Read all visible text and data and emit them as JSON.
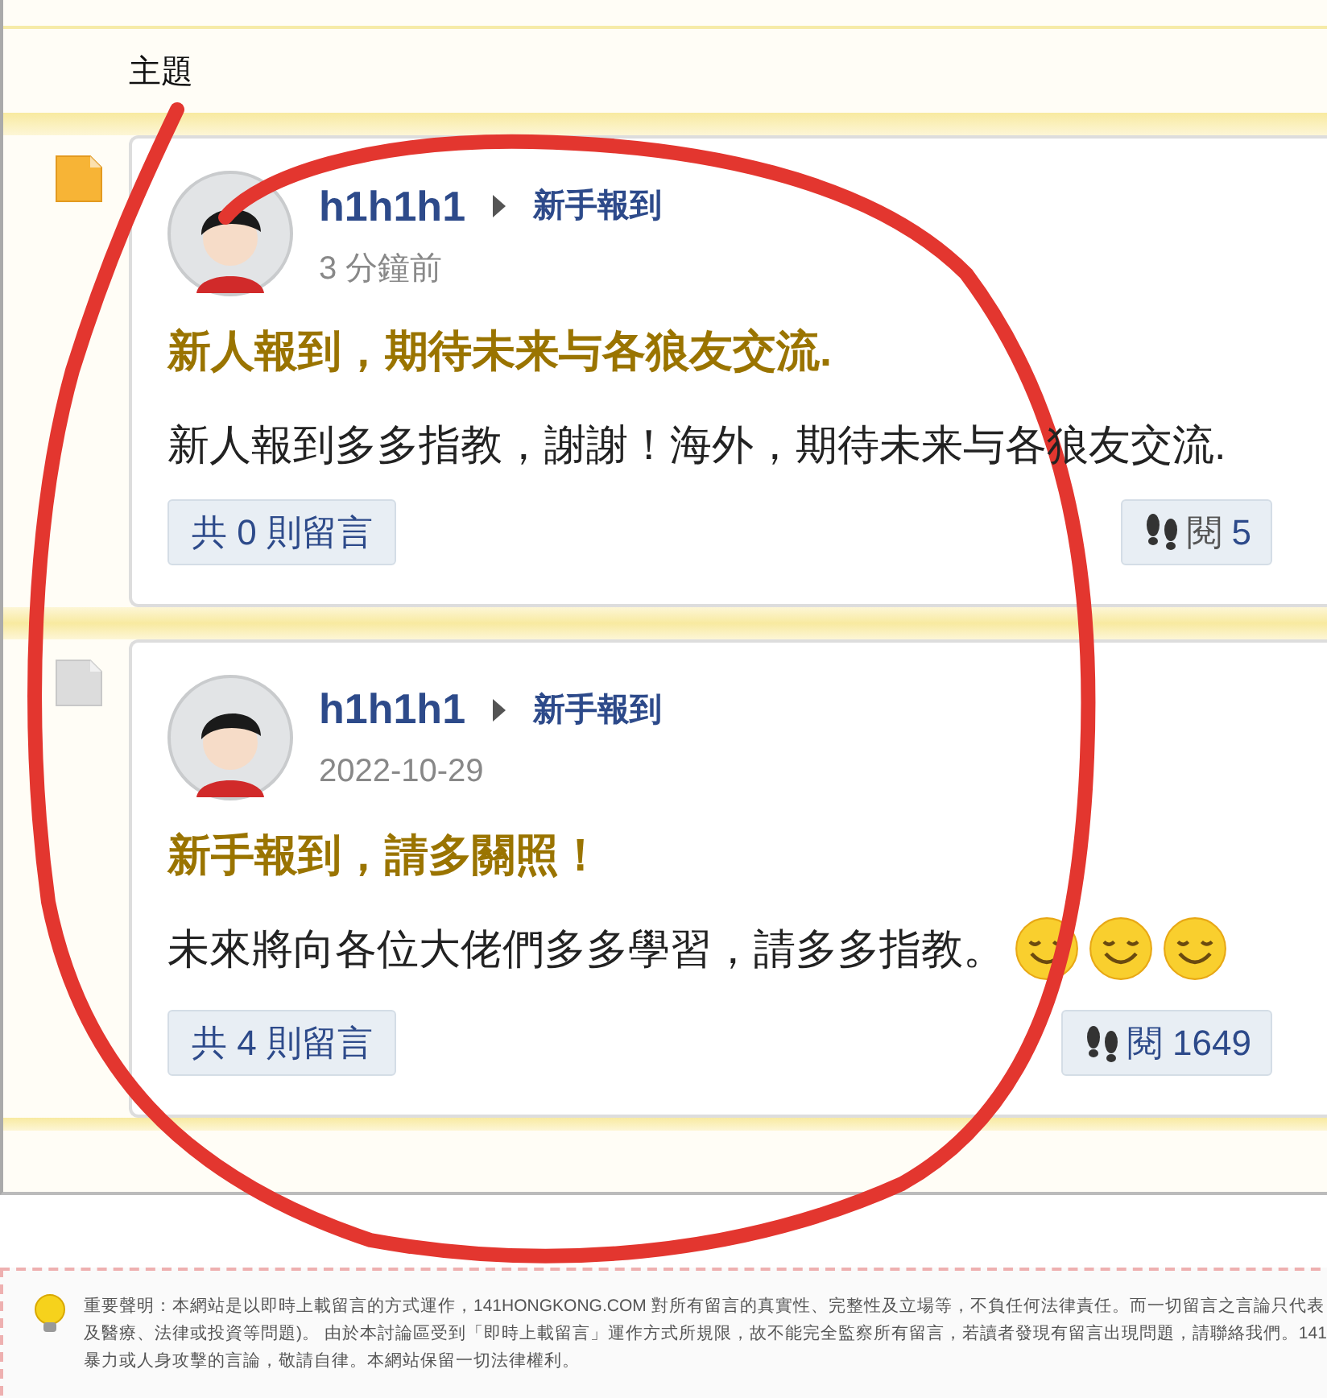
{
  "header": {
    "column_label": "主題"
  },
  "posts": [
    {
      "unread": true,
      "author": "h1h1h1",
      "forum": "新手報到",
      "time": "3 分鐘前",
      "title": "新人報到，期待未来与各狼友交流.",
      "body": [
        {
          "kind": "text",
          "text": "新人報到多多指教，謝謝！海外，期待未来与各狼友交流."
        }
      ],
      "replies": "共 0 則留言",
      "views_label": "閱",
      "views": "5",
      "popular": false
    },
    {
      "unread": false,
      "author": "h1h1h1",
      "forum": "新手報到",
      "time": "2022-10-29",
      "title": "新手報到，請多關照！",
      "body": [
        {
          "kind": "text",
          "text": "未來將向各位大佬們多多學習，請多多指教。"
        },
        {
          "kind": "emoticon"
        },
        {
          "kind": "emoticon"
        },
        {
          "kind": "emoticon"
        }
      ],
      "replies": "共 4 則留言",
      "views_label": "閱",
      "views": "1649",
      "popular": true
    }
  ],
  "disclaimer": {
    "lines": [
      "重要聲明：本網站是以即時上載留言的方式運作，141HONGKONG.COM 對所有留言的真實性、完整性及立場等，不負任何法律責任。而一切留言之言論只代表",
      "及醫療、法律或投資等問題)。 由於本討論區受到「即時上載留言」運作方式所規限，故不能完全監察所有留言，若讀者發現有留言出現問題，請聯絡我們。141",
      "暴力或人身攻擊的言論，敬請自律。本網站保留一切法律權利。"
    ]
  }
}
